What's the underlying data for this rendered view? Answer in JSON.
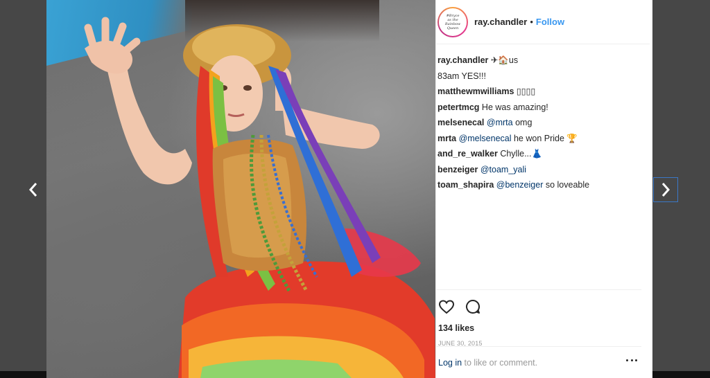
{
  "post": {
    "username": "ray.chandler",
    "follow_label": "Follow",
    "separator": "•",
    "avatar_text": [
      "#Bryce",
      "as the",
      "Rainbow",
      "Queen"
    ]
  },
  "comments": [
    {
      "author": "ray.chandler",
      "pre": " ✈🏠us",
      "mention": "",
      "post": ""
    },
    {
      "author": "",
      "pre": "83am YES!!!",
      "mention": "",
      "post": ""
    },
    {
      "author": "matthewmwilliams",
      "pre": " ▯▯▯▯",
      "mention": "",
      "post": ""
    },
    {
      "author": "petertmcg",
      "pre": " He was amazing!",
      "mention": "",
      "post": ""
    },
    {
      "author": "melsenecal",
      "pre": " ",
      "mention": "@mrta",
      "post": " omg"
    },
    {
      "author": "mrta",
      "pre": " ",
      "mention": "@melsenecal",
      "post": " he won Pride 🏆"
    },
    {
      "author": "and_re_walker",
      "pre": " Chylle...👗",
      "mention": "",
      "post": ""
    },
    {
      "author": "benzeiger",
      "pre": " ",
      "mention": "@toam_yali",
      "post": ""
    },
    {
      "author": "toam_shapira",
      "pre": " ",
      "mention": "@benzeiger",
      "post": " so loveable"
    }
  ],
  "likes": "134 likes",
  "date": "JUNE 30, 2015",
  "footer": {
    "login_link": "Log in",
    "login_rest": " to like or comment."
  },
  "icons": {
    "prev": "chevron-left-icon",
    "next": "chevron-right-icon",
    "like": "heart-icon",
    "comment": "comment-bubble-icon",
    "more": "more-options-icon"
  },
  "colors": {
    "accent": "#3897f0",
    "mention": "#003569",
    "muted": "#999999",
    "backdrop": "#474747"
  }
}
